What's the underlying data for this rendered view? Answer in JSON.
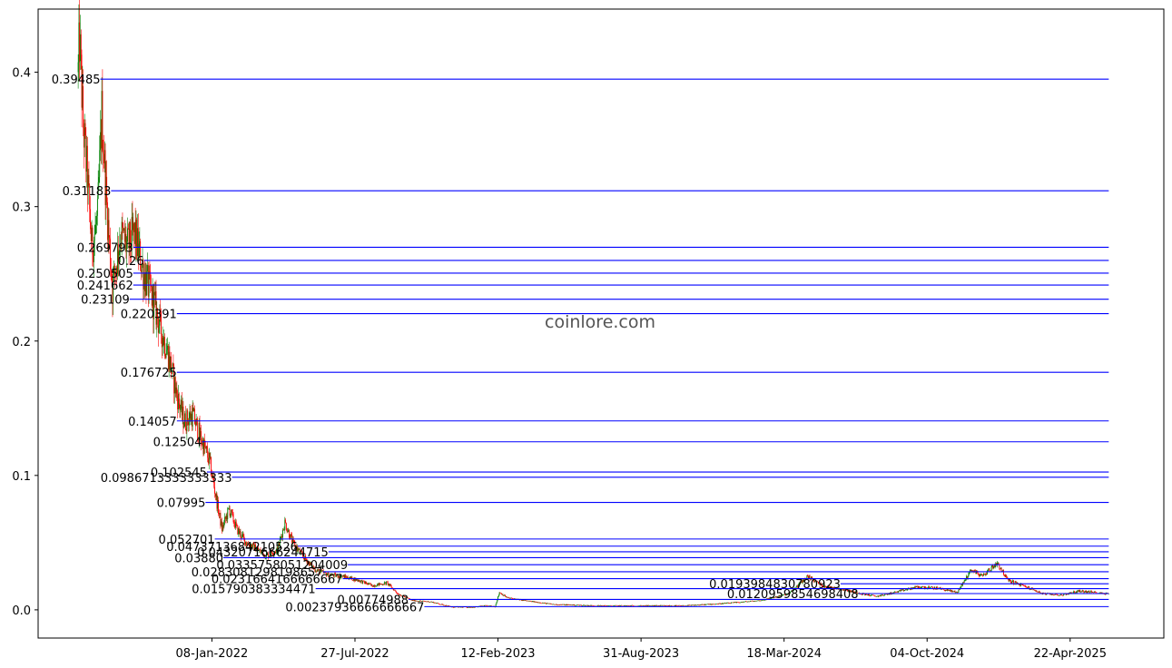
{
  "watermark": "coinlore.com",
  "chart_data": {
    "type": "candlestick",
    "title": "",
    "xlabel": "",
    "ylabel": "",
    "ylim": [
      -0.021,
      0.447
    ],
    "x_range": [
      "2021-05-10",
      "2025-08-31"
    ],
    "x_ticks": [
      {
        "date": "2022-01-08",
        "label": "08-Jan-2022"
      },
      {
        "date": "2022-07-27",
        "label": "27-Jul-2022"
      },
      {
        "date": "2023-02-12",
        "label": "12-Feb-2023"
      },
      {
        "date": "2023-08-31",
        "label": "31-Aug-2023"
      },
      {
        "date": "2024-03-18",
        "label": "18-Mar-2024"
      },
      {
        "date": "2024-10-04",
        "label": "04-Oct-2024"
      },
      {
        "date": "2025-04-22",
        "label": "22-Apr-2025"
      }
    ],
    "y_ticks": [
      {
        "value": 0.0,
        "label": "0.0"
      },
      {
        "value": 0.1,
        "label": "0.1"
      },
      {
        "value": 0.2,
        "label": "0.2"
      },
      {
        "value": 0.3,
        "label": "0.3"
      },
      {
        "value": 0.4,
        "label": "0.4"
      }
    ],
    "colors": {
      "up": "#008000",
      "down": "#ff0000",
      "level_line": "#0000ff"
    },
    "levels": [
      {
        "value": 0.39485,
        "label": "0.39485",
        "start": "2021-08-05"
      },
      {
        "value": 0.31183,
        "label": "0.31183",
        "start": "2021-08-20"
      },
      {
        "value": 0.269793,
        "label": "0.269793",
        "start": "2021-09-20"
      },
      {
        "value": 0.26,
        "label": "0.26",
        "start": "2021-10-05"
      },
      {
        "value": 0.250505,
        "label": "0.250505",
        "start": "2021-09-20"
      },
      {
        "value": 0.241662,
        "label": "0.241662",
        "start": "2021-09-20"
      },
      {
        "value": 0.23109,
        "label": "0.23109",
        "start": "2021-09-15"
      },
      {
        "value": 0.220391,
        "label": "0.220391",
        "start": "2021-11-20"
      },
      {
        "value": 0.176725,
        "label": "0.176725",
        "start": "2021-11-20"
      },
      {
        "value": 0.14057,
        "label": "0.14057",
        "start": "2021-11-20"
      },
      {
        "value": 0.12504,
        "label": "0.12504",
        "start": "2021-12-25"
      },
      {
        "value": 0.102545,
        "label": "0.102545",
        "start": "2022-01-01"
      },
      {
        "value": 0.0986713333333333,
        "label": "0.0986713333333333",
        "start": "2022-02-05"
      },
      {
        "value": 0.07995,
        "label": "0.07995",
        "start": "2021-12-30"
      },
      {
        "value": 0.052701,
        "label": "0.052701",
        "start": "2022-01-12"
      },
      {
        "value": 0.0473713684210526,
        "label": "0.0473713684210526",
        "start": "2022-05-08"
      },
      {
        "value": 0.0432071666244715,
        "label": "0.0432071666244715",
        "start": "2022-06-20"
      },
      {
        "value": 0.0388,
        "label": "0.03880",
        "start": "2022-01-24"
      },
      {
        "value": 0.0335758051204009,
        "label": "0.0335758051204009",
        "start": "2022-07-17"
      },
      {
        "value": 0.0283081298198657,
        "label": "0.0283081298198657",
        "start": "2022-06-12"
      },
      {
        "value": 0.0231664166666667,
        "label": "0.0231664166666667",
        "start": "2022-07-10"
      },
      {
        "value": 0.0193984830780923,
        "label": "0.0193984830780923",
        "start": "2024-06-05"
      },
      {
        "value": 0.015790383334471,
        "label": "0.015790383334471",
        "start": "2022-06-02"
      },
      {
        "value": 0.0120959854698408,
        "label": "0.0120959854698408",
        "start": "2024-06-30"
      },
      {
        "value": 0.00774988,
        "label": "0.00774988",
        "start": "2022-10-10"
      },
      {
        "value": 0.00237936666666667,
        "label": "0.00237936666666667",
        "start": "2022-11-01"
      }
    ],
    "level_end": "2025-06-15",
    "price_path": [
      {
        "date": "2021-07-05",
        "value": 0.4
      },
      {
        "date": "2021-07-07",
        "value": 0.425
      },
      {
        "date": "2021-07-12",
        "value": 0.36
      },
      {
        "date": "2021-07-18",
        "value": 0.32
      },
      {
        "date": "2021-07-24",
        "value": 0.27
      },
      {
        "date": "2021-08-01",
        "value": 0.29
      },
      {
        "date": "2021-08-07",
        "value": 0.37
      },
      {
        "date": "2021-08-14",
        "value": 0.3
      },
      {
        "date": "2021-08-22",
        "value": 0.24
      },
      {
        "date": "2021-09-02",
        "value": 0.28
      },
      {
        "date": "2021-09-12",
        "value": 0.27
      },
      {
        "date": "2021-09-22",
        "value": 0.28
      },
      {
        "date": "2021-10-05",
        "value": 0.25
      },
      {
        "date": "2021-10-18",
        "value": 0.23
      },
      {
        "date": "2021-10-28",
        "value": 0.21
      },
      {
        "date": "2021-11-08",
        "value": 0.19
      },
      {
        "date": "2021-11-20",
        "value": 0.16
      },
      {
        "date": "2021-11-30",
        "value": 0.14
      },
      {
        "date": "2021-12-12",
        "value": 0.145
      },
      {
        "date": "2021-12-22",
        "value": 0.13
      },
      {
        "date": "2022-01-05",
        "value": 0.11
      },
      {
        "date": "2022-01-15",
        "value": 0.08
      },
      {
        "date": "2022-01-22",
        "value": 0.06
      },
      {
        "date": "2022-02-01",
        "value": 0.075
      },
      {
        "date": "2022-02-12",
        "value": 0.06
      },
      {
        "date": "2022-02-25",
        "value": 0.05
      },
      {
        "date": "2022-03-10",
        "value": 0.046
      },
      {
        "date": "2022-03-25",
        "value": 0.04
      },
      {
        "date": "2022-04-10",
        "value": 0.045
      },
      {
        "date": "2022-04-20",
        "value": 0.065
      },
      {
        "date": "2022-05-01",
        "value": 0.05
      },
      {
        "date": "2022-05-15",
        "value": 0.04
      },
      {
        "date": "2022-06-01",
        "value": 0.03
      },
      {
        "date": "2022-06-20",
        "value": 0.026
      },
      {
        "date": "2022-07-10",
        "value": 0.025
      },
      {
        "date": "2022-08-01",
        "value": 0.022
      },
      {
        "date": "2022-08-20",
        "value": 0.018
      },
      {
        "date": "2022-09-10",
        "value": 0.02
      },
      {
        "date": "2022-09-25",
        "value": 0.012
      },
      {
        "date": "2022-10-15",
        "value": 0.007
      },
      {
        "date": "2022-11-10",
        "value": 0.006
      },
      {
        "date": "2022-12-10",
        "value": 0.002
      },
      {
        "date": "2023-01-10",
        "value": 0.002
      },
      {
        "date": "2023-01-25",
        "value": 0.003
      },
      {
        "date": "2023-02-08",
        "value": 0.0025
      },
      {
        "date": "2023-02-14",
        "value": 0.013
      },
      {
        "date": "2023-02-25",
        "value": 0.009
      },
      {
        "date": "2023-03-20",
        "value": 0.007
      },
      {
        "date": "2023-05-01",
        "value": 0.004
      },
      {
        "date": "2023-07-01",
        "value": 0.003
      },
      {
        "date": "2023-09-01",
        "value": 0.003
      },
      {
        "date": "2023-11-01",
        "value": 0.003
      },
      {
        "date": "2024-01-01",
        "value": 0.005
      },
      {
        "date": "2024-02-15",
        "value": 0.007
      },
      {
        "date": "2024-03-25",
        "value": 0.012
      },
      {
        "date": "2024-04-20",
        "value": 0.025
      },
      {
        "date": "2024-05-10",
        "value": 0.018
      },
      {
        "date": "2024-06-10",
        "value": 0.015
      },
      {
        "date": "2024-07-05",
        "value": 0.012
      },
      {
        "date": "2024-07-25",
        "value": 0.01
      },
      {
        "date": "2024-08-20",
        "value": 0.013
      },
      {
        "date": "2024-09-20",
        "value": 0.017
      },
      {
        "date": "2024-10-20",
        "value": 0.016
      },
      {
        "date": "2024-11-15",
        "value": 0.013
      },
      {
        "date": "2024-12-05",
        "value": 0.03
      },
      {
        "date": "2024-12-20",
        "value": 0.025
      },
      {
        "date": "2025-01-10",
        "value": 0.035
      },
      {
        "date": "2025-01-25",
        "value": 0.022
      },
      {
        "date": "2025-02-20",
        "value": 0.017
      },
      {
        "date": "2025-03-15",
        "value": 0.012
      },
      {
        "date": "2025-04-10",
        "value": 0.011
      },
      {
        "date": "2025-05-05",
        "value": 0.014
      },
      {
        "date": "2025-05-25",
        "value": 0.013
      },
      {
        "date": "2025-06-15",
        "value": 0.012
      }
    ]
  }
}
